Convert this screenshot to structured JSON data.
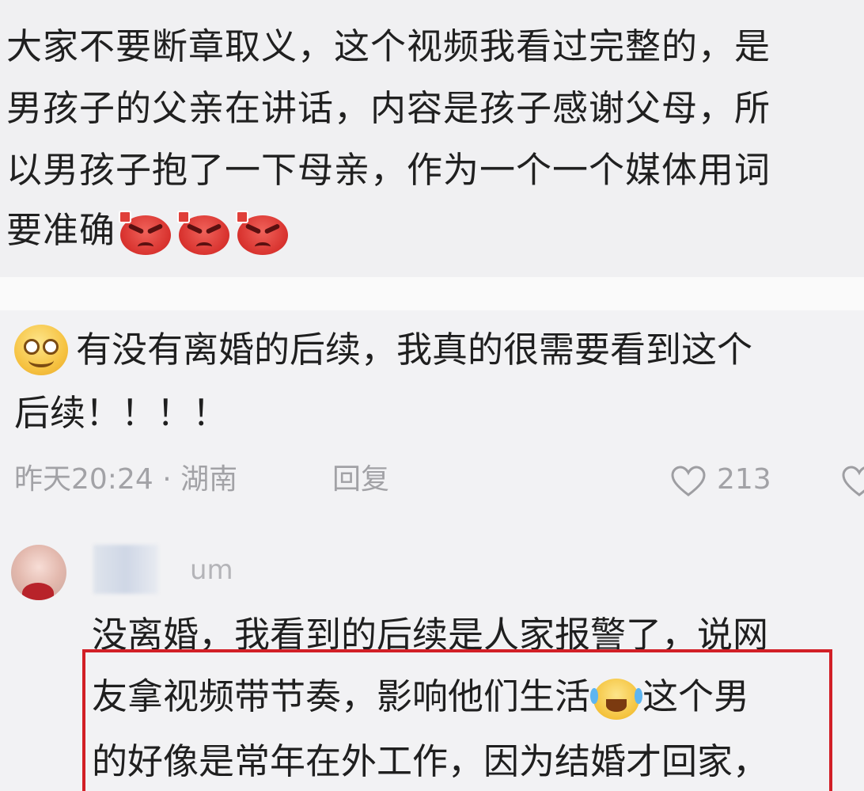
{
  "top_comment": {
    "lines": [
      "大家不要断章取义，这个视频我看过完整的，是",
      "男孩子的父亲在讲话，内容是孩子感谢父母，所",
      "以男孩子抱了一下母亲，作为一个一个媒体用词",
      "要准确"
    ],
    "emoji": "angry-face-icon"
  },
  "comment": {
    "emoji": "smile-face-icon",
    "line1": "有没有离婚的后续，我真的很需要看到这个",
    "line2": "后续！！！！",
    "time_location": "昨天20:24 · 湖南",
    "reply_label": "回复",
    "like_count": "213"
  },
  "reply": {
    "username_tail": "um",
    "line1": "没离婚，我看到的后续是人家报警了，说网",
    "line2_a": "友拿视频带节奏，影响他们生活",
    "line2_b": "这个男",
    "line3": "的好像是常年在外工作，因为结婚才回家，",
    "highlight_color": "#d21f26"
  }
}
